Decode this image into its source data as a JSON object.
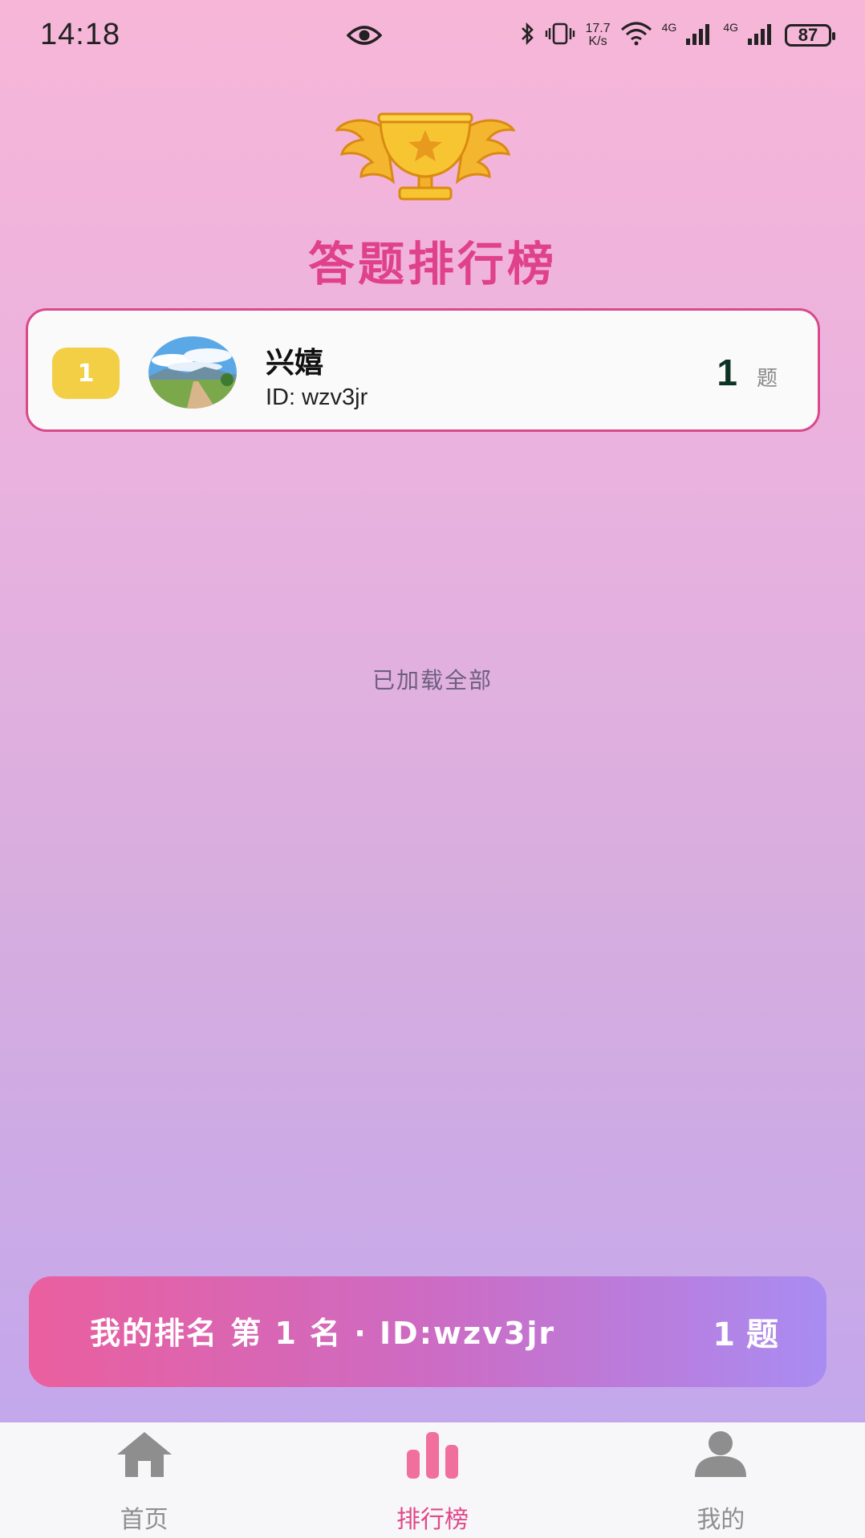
{
  "status_bar": {
    "time": "14:18",
    "speed_top": "17.7",
    "speed_bottom": "K/s",
    "net1": "4G",
    "net2": "4G",
    "battery": "87"
  },
  "header": {
    "title": "答题排行榜",
    "icon": "trophy-icon"
  },
  "leaderboard": [
    {
      "rank": "1",
      "name": "兴嬉",
      "id_text": "ID: wzv3jr",
      "score": "1",
      "unit": "题"
    }
  ],
  "load_status": "已加载全部",
  "my_rank": {
    "text": "我的排名 第 1 名 · ID:wzv3jr",
    "score": "1 题"
  },
  "nav": [
    {
      "label": "首页",
      "icon": "home-icon",
      "active": false
    },
    {
      "label": "排行榜",
      "icon": "leaderboard-icon",
      "active": true
    },
    {
      "label": "我的",
      "icon": "profile-icon",
      "active": false
    }
  ],
  "colors": {
    "accent": "#e0418b",
    "badge_gold": "#f3cf46",
    "nav_active": "#e0498a",
    "nav_inactive": "#8e8e8e"
  }
}
